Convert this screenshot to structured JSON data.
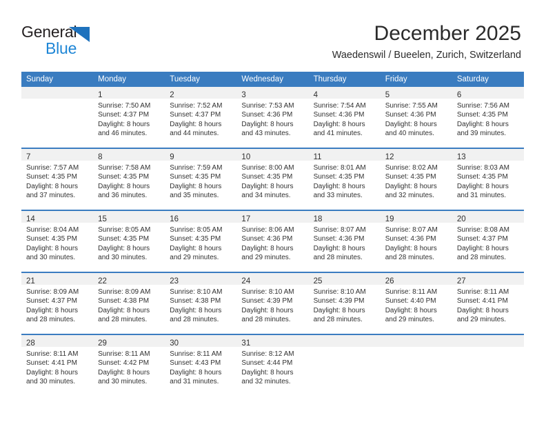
{
  "brand": {
    "line1": "General",
    "line2": "Blue",
    "triangle_color": "#1e72bd",
    "line2_color": "#1e86d6"
  },
  "header": {
    "title": "December 2025",
    "subtitle": "Waedenswil / Bueelen, Zurich, Switzerland"
  },
  "theme": {
    "header_blue": "#3a7cc0",
    "daynum_band": "#f1f1f1",
    "text": "#303030"
  },
  "calendar": {
    "weekday_headers": [
      "Sunday",
      "Monday",
      "Tuesday",
      "Wednesday",
      "Thursday",
      "Friday",
      "Saturday"
    ],
    "weeks": [
      [
        {
          "day": "",
          "lines": []
        },
        {
          "day": "1",
          "lines": [
            "Sunrise: 7:50 AM",
            "Sunset: 4:37 PM",
            "Daylight: 8 hours",
            "and 46 minutes."
          ]
        },
        {
          "day": "2",
          "lines": [
            "Sunrise: 7:52 AM",
            "Sunset: 4:37 PM",
            "Daylight: 8 hours",
            "and 44 minutes."
          ]
        },
        {
          "day": "3",
          "lines": [
            "Sunrise: 7:53 AM",
            "Sunset: 4:36 PM",
            "Daylight: 8 hours",
            "and 43 minutes."
          ]
        },
        {
          "day": "4",
          "lines": [
            "Sunrise: 7:54 AM",
            "Sunset: 4:36 PM",
            "Daylight: 8 hours",
            "and 41 minutes."
          ]
        },
        {
          "day": "5",
          "lines": [
            "Sunrise: 7:55 AM",
            "Sunset: 4:36 PM",
            "Daylight: 8 hours",
            "and 40 minutes."
          ]
        },
        {
          "day": "6",
          "lines": [
            "Sunrise: 7:56 AM",
            "Sunset: 4:35 PM",
            "Daylight: 8 hours",
            "and 39 minutes."
          ]
        }
      ],
      [
        {
          "day": "7",
          "lines": [
            "Sunrise: 7:57 AM",
            "Sunset: 4:35 PM",
            "Daylight: 8 hours",
            "and 37 minutes."
          ]
        },
        {
          "day": "8",
          "lines": [
            "Sunrise: 7:58 AM",
            "Sunset: 4:35 PM",
            "Daylight: 8 hours",
            "and 36 minutes."
          ]
        },
        {
          "day": "9",
          "lines": [
            "Sunrise: 7:59 AM",
            "Sunset: 4:35 PM",
            "Daylight: 8 hours",
            "and 35 minutes."
          ]
        },
        {
          "day": "10",
          "lines": [
            "Sunrise: 8:00 AM",
            "Sunset: 4:35 PM",
            "Daylight: 8 hours",
            "and 34 minutes."
          ]
        },
        {
          "day": "11",
          "lines": [
            "Sunrise: 8:01 AM",
            "Sunset: 4:35 PM",
            "Daylight: 8 hours",
            "and 33 minutes."
          ]
        },
        {
          "day": "12",
          "lines": [
            "Sunrise: 8:02 AM",
            "Sunset: 4:35 PM",
            "Daylight: 8 hours",
            "and 32 minutes."
          ]
        },
        {
          "day": "13",
          "lines": [
            "Sunrise: 8:03 AM",
            "Sunset: 4:35 PM",
            "Daylight: 8 hours",
            "and 31 minutes."
          ]
        }
      ],
      [
        {
          "day": "14",
          "lines": [
            "Sunrise: 8:04 AM",
            "Sunset: 4:35 PM",
            "Daylight: 8 hours",
            "and 30 minutes."
          ]
        },
        {
          "day": "15",
          "lines": [
            "Sunrise: 8:05 AM",
            "Sunset: 4:35 PM",
            "Daylight: 8 hours",
            "and 30 minutes."
          ]
        },
        {
          "day": "16",
          "lines": [
            "Sunrise: 8:05 AM",
            "Sunset: 4:35 PM",
            "Daylight: 8 hours",
            "and 29 minutes."
          ]
        },
        {
          "day": "17",
          "lines": [
            "Sunrise: 8:06 AM",
            "Sunset: 4:36 PM",
            "Daylight: 8 hours",
            "and 29 minutes."
          ]
        },
        {
          "day": "18",
          "lines": [
            "Sunrise: 8:07 AM",
            "Sunset: 4:36 PM",
            "Daylight: 8 hours",
            "and 28 minutes."
          ]
        },
        {
          "day": "19",
          "lines": [
            "Sunrise: 8:07 AM",
            "Sunset: 4:36 PM",
            "Daylight: 8 hours",
            "and 28 minutes."
          ]
        },
        {
          "day": "20",
          "lines": [
            "Sunrise: 8:08 AM",
            "Sunset: 4:37 PM",
            "Daylight: 8 hours",
            "and 28 minutes."
          ]
        }
      ],
      [
        {
          "day": "21",
          "lines": [
            "Sunrise: 8:09 AM",
            "Sunset: 4:37 PM",
            "Daylight: 8 hours",
            "and 28 minutes."
          ]
        },
        {
          "day": "22",
          "lines": [
            "Sunrise: 8:09 AM",
            "Sunset: 4:38 PM",
            "Daylight: 8 hours",
            "and 28 minutes."
          ]
        },
        {
          "day": "23",
          "lines": [
            "Sunrise: 8:10 AM",
            "Sunset: 4:38 PM",
            "Daylight: 8 hours",
            "and 28 minutes."
          ]
        },
        {
          "day": "24",
          "lines": [
            "Sunrise: 8:10 AM",
            "Sunset: 4:39 PM",
            "Daylight: 8 hours",
            "and 28 minutes."
          ]
        },
        {
          "day": "25",
          "lines": [
            "Sunrise: 8:10 AM",
            "Sunset: 4:39 PM",
            "Daylight: 8 hours",
            "and 28 minutes."
          ]
        },
        {
          "day": "26",
          "lines": [
            "Sunrise: 8:11 AM",
            "Sunset: 4:40 PM",
            "Daylight: 8 hours",
            "and 29 minutes."
          ]
        },
        {
          "day": "27",
          "lines": [
            "Sunrise: 8:11 AM",
            "Sunset: 4:41 PM",
            "Daylight: 8 hours",
            "and 29 minutes."
          ]
        }
      ],
      [
        {
          "day": "28",
          "lines": [
            "Sunrise: 8:11 AM",
            "Sunset: 4:41 PM",
            "Daylight: 8 hours",
            "and 30 minutes."
          ]
        },
        {
          "day": "29",
          "lines": [
            "Sunrise: 8:11 AM",
            "Sunset: 4:42 PM",
            "Daylight: 8 hours",
            "and 30 minutes."
          ]
        },
        {
          "day": "30",
          "lines": [
            "Sunrise: 8:11 AM",
            "Sunset: 4:43 PM",
            "Daylight: 8 hours",
            "and 31 minutes."
          ]
        },
        {
          "day": "31",
          "lines": [
            "Sunrise: 8:12 AM",
            "Sunset: 4:44 PM",
            "Daylight: 8 hours",
            "and 32 minutes."
          ]
        },
        {
          "day": "",
          "lines": []
        },
        {
          "day": "",
          "lines": []
        },
        {
          "day": "",
          "lines": []
        }
      ]
    ]
  }
}
